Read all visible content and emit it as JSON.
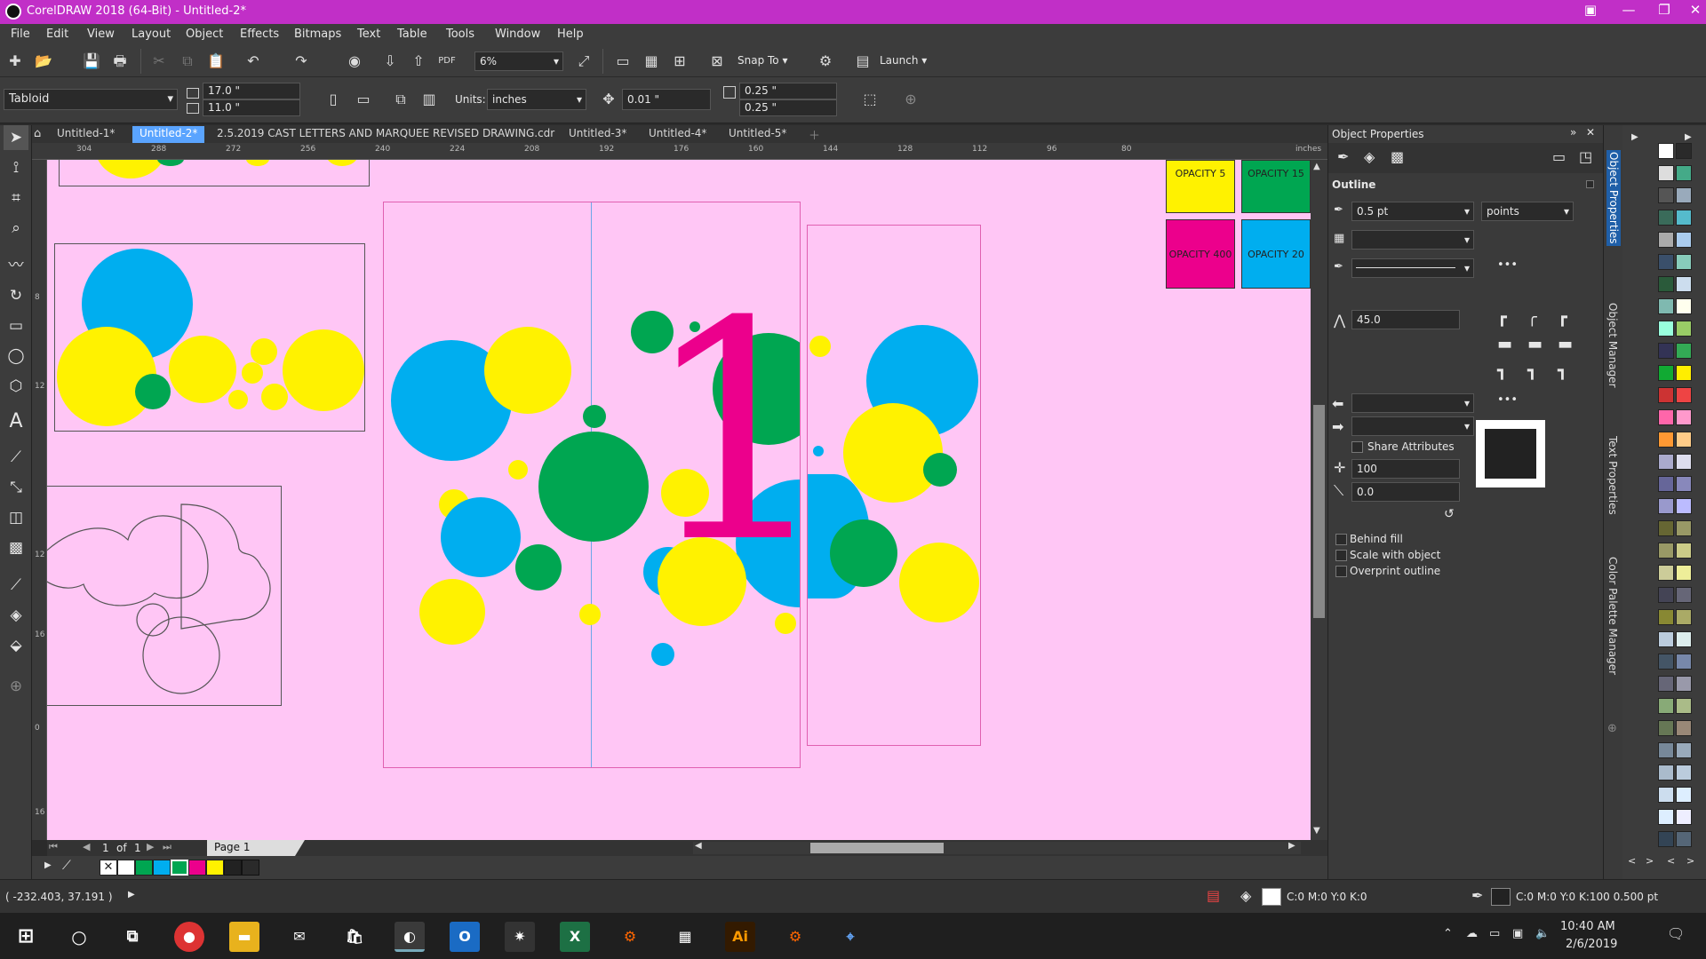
{
  "title": "CorelDRAW 2018 (64-Bit) - Untitled-2*",
  "menu": [
    "File",
    "Edit",
    "View",
    "Layout",
    "Object",
    "Effects",
    "Bitmaps",
    "Text",
    "Table",
    "Tools",
    "Window",
    "Help"
  ],
  "toolbar1": {
    "zoom": "6%",
    "snap_to": "Snap To",
    "launch": "Launch"
  },
  "toolbar2": {
    "page_size": "Tabloid",
    "width": "17.0 \"",
    "height": "11.0 \"",
    "units_label": "Units:",
    "units": "inches",
    "nudge": "0.01 \"",
    "dup_x": "0.25 \"",
    "dup_y": "0.25 \""
  },
  "tabs": [
    "Untitled-1*",
    "Untitled-2*",
    "2.5.2019 CAST LETTERS AND MARQUEE REVISED DRAWING.cdr",
    "Untitled-3*",
    "Untitled-4*",
    "Untitled-5*"
  ],
  "active_tab": 1,
  "ruler_top": [
    "304",
    "288",
    "272",
    "256",
    "240",
    "224",
    "208",
    "192",
    "176",
    "160",
    "144",
    "128",
    "112",
    "96",
    "80",
    "inches"
  ],
  "ruler_left": [
    "8",
    "12",
    "12",
    "16",
    "0",
    "16"
  ],
  "swatches": {
    "opacity5": "OPACITY 5",
    "opacity15": "OPACITY 15",
    "opacity400": "OPACITY 400",
    "opacity20": "OPACITY 20"
  },
  "big_numeral": "1",
  "page_nav": {
    "current": "1",
    "of": "of",
    "total": "1",
    "page_tab": "Page 1"
  },
  "status": {
    "coords": "( -232.403, 37.191 )",
    "fill": "C:0 M:0 Y:0 K:0",
    "outline": "C:0 M:0 Y:0 K:100  0.500 pt"
  },
  "props": {
    "title": "Object Properties",
    "section": "Outline",
    "width": "0.5 pt",
    "unit": "points",
    "miter": "45.0",
    "share_attributes": "Share Attributes",
    "stretch": "100",
    "angle": "0.0",
    "behind_fill": "Behind fill",
    "scale_with_object": "Scale with object",
    "overprint_outline": "Overprint outline"
  },
  "dock": [
    "Object Properties",
    "Object Manager",
    "Text Properties",
    "Color Palette Manager"
  ],
  "clock": {
    "time": "10:40 AM",
    "date": "2/6/2019"
  },
  "colors": {
    "pink": "#ffc6f5",
    "yellow": "#fff200",
    "blue": "#00aeef",
    "green": "#00a651",
    "magenta": "#ec008c",
    "title": "#c12fc7"
  }
}
